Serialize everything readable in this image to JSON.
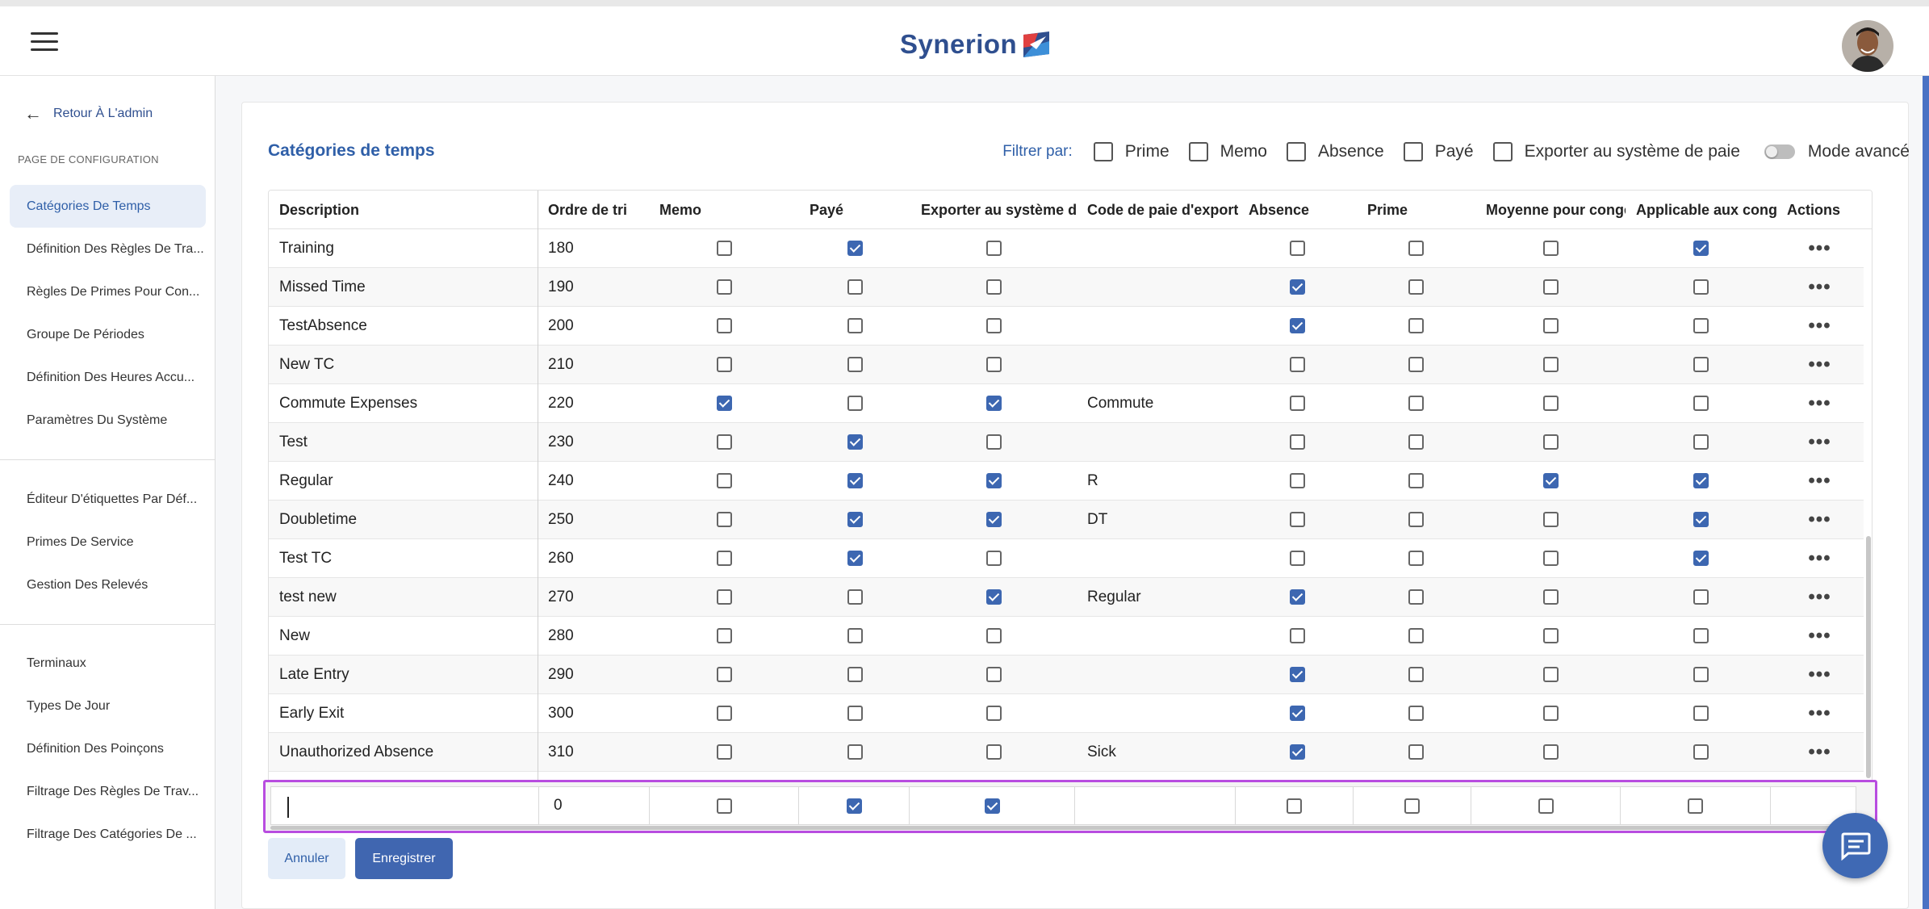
{
  "header": {
    "logo_text": "Synerion",
    "menu_icon": "hamburger-icon",
    "avatar": "user-avatar",
    "brand_color": "#2f4f8f"
  },
  "sidebar": {
    "back_label": "Retour À L'admin",
    "section_title": "PAGE DE CONFIGURATION",
    "groups": [
      {
        "items": [
          {
            "label": "Catégories De Temps",
            "active": true
          },
          {
            "label": "Définition Des Règles De Tra..."
          },
          {
            "label": "Règles De Primes Pour Con..."
          },
          {
            "label": "Groupe De Périodes"
          },
          {
            "label": "Définition Des Heures Accu..."
          },
          {
            "label": "Paramètres Du Système"
          }
        ]
      },
      {
        "items": [
          {
            "label": "Éditeur D'étiquettes Par Déf..."
          },
          {
            "label": "Primes De Service"
          },
          {
            "label": "Gestion Des Relevés"
          }
        ]
      },
      {
        "items": [
          {
            "label": "Terminaux"
          },
          {
            "label": "Types De Jour"
          },
          {
            "label": "Définition Des Poinçons"
          },
          {
            "label": "Filtrage Des Règles De Trav..."
          },
          {
            "label": "Filtrage Des Catégories De ..."
          }
        ]
      }
    ]
  },
  "page": {
    "title": "Catégories de temps",
    "filter_label": "Filtrer par:",
    "filters": [
      "Prime",
      "Memo",
      "Absence",
      "Payé",
      "Exporter au système de paie"
    ],
    "advanced_mode_label": "Mode avancé",
    "advanced_mode_on": false
  },
  "table": {
    "columns": [
      "Description",
      "Ordre de tri",
      "Memo",
      "Payé",
      "Exporter au système de paie",
      "Code de paie d'exportation",
      "Absence",
      "Prime",
      "Moyenne pour congés",
      "Applicable aux congés",
      "Actions"
    ],
    "rows": [
      {
        "desc": "Training",
        "order": "180",
        "memo": false,
        "paye": true,
        "export": false,
        "code": "",
        "absence": false,
        "prime": false,
        "moyenne": false,
        "applicable": true
      },
      {
        "desc": "Missed Time",
        "order": "190",
        "memo": false,
        "paye": false,
        "export": false,
        "code": "",
        "absence": true,
        "prime": false,
        "moyenne": false,
        "applicable": false
      },
      {
        "desc": "TestAbsence",
        "order": "200",
        "memo": false,
        "paye": false,
        "export": false,
        "code": "",
        "absence": true,
        "prime": false,
        "moyenne": false,
        "applicable": false
      },
      {
        "desc": "New TC",
        "order": "210",
        "memo": false,
        "paye": false,
        "export": false,
        "code": "",
        "absence": false,
        "prime": false,
        "moyenne": false,
        "applicable": false
      },
      {
        "desc": "Commute Expenses",
        "order": "220",
        "memo": true,
        "paye": false,
        "export": true,
        "code": "Commute",
        "absence": false,
        "prime": false,
        "moyenne": false,
        "applicable": false
      },
      {
        "desc": "Test",
        "order": "230",
        "memo": false,
        "paye": true,
        "export": false,
        "code": "",
        "absence": false,
        "prime": false,
        "moyenne": false,
        "applicable": false
      },
      {
        "desc": "Regular",
        "order": "240",
        "memo": false,
        "paye": true,
        "export": true,
        "code": "R",
        "absence": false,
        "prime": false,
        "moyenne": true,
        "applicable": true
      },
      {
        "desc": "Doubletime",
        "order": "250",
        "memo": false,
        "paye": true,
        "export": true,
        "code": "DT",
        "absence": false,
        "prime": false,
        "moyenne": false,
        "applicable": true
      },
      {
        "desc": "Test TC",
        "order": "260",
        "memo": false,
        "paye": true,
        "export": false,
        "code": "",
        "absence": false,
        "prime": false,
        "moyenne": false,
        "applicable": true
      },
      {
        "desc": "test new",
        "order": "270",
        "memo": false,
        "paye": false,
        "export": true,
        "code": "Regular",
        "absence": true,
        "prime": false,
        "moyenne": false,
        "applicable": false
      },
      {
        "desc": "New",
        "order": "280",
        "memo": false,
        "paye": false,
        "export": false,
        "code": "",
        "absence": false,
        "prime": false,
        "moyenne": false,
        "applicable": false
      },
      {
        "desc": "Late Entry",
        "order": "290",
        "memo": false,
        "paye": false,
        "export": false,
        "code": "",
        "absence": true,
        "prime": false,
        "moyenne": false,
        "applicable": false
      },
      {
        "desc": "Early Exit",
        "order": "300",
        "memo": false,
        "paye": false,
        "export": false,
        "code": "",
        "absence": true,
        "prime": false,
        "moyenne": false,
        "applicable": false
      },
      {
        "desc": "Unauthorized Absence",
        "order": "310",
        "memo": false,
        "paye": false,
        "export": false,
        "code": "Sick",
        "absence": true,
        "prime": false,
        "moyenne": false,
        "applicable": false
      }
    ],
    "actions_icon": "more-horizontal-icon"
  },
  "new_row": {
    "desc_value": "",
    "order_value": "0",
    "memo": false,
    "paye": true,
    "export": true,
    "code": "",
    "absence": false,
    "prime": false,
    "moyenne": false,
    "applicable": false
  },
  "buttons": {
    "cancel": "Annuler",
    "save": "Enregistrer"
  },
  "chat_icon": "chat-icon",
  "colors": {
    "accent": "#3d67b1",
    "highlight": "#b84de0",
    "title": "#2f5fa8"
  }
}
